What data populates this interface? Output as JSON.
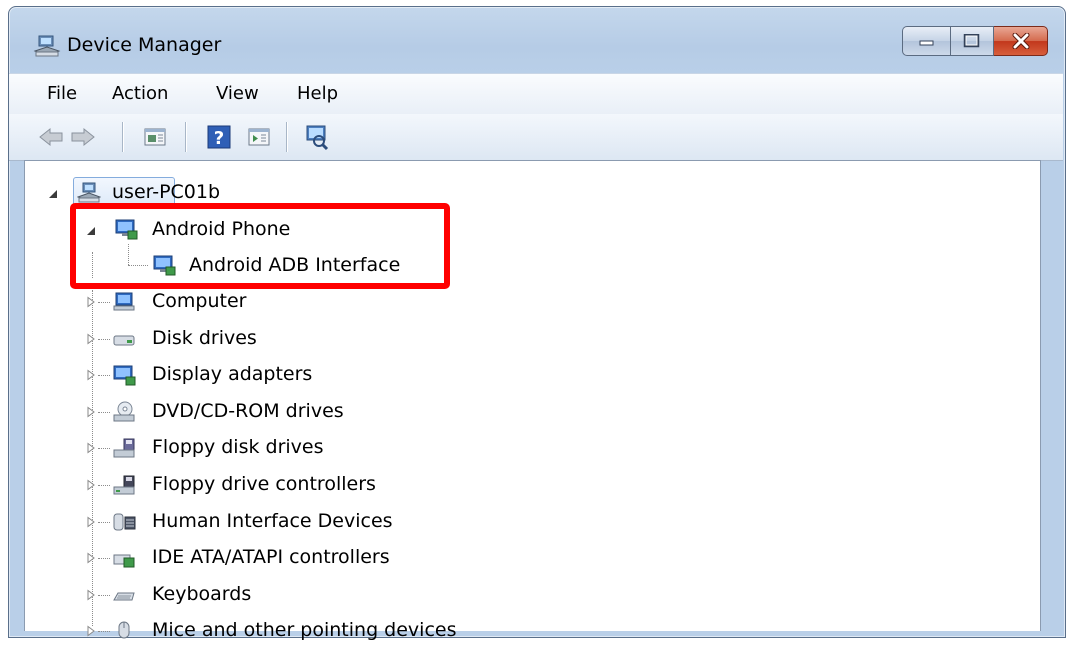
{
  "window": {
    "title": "Device Manager"
  },
  "caption": {
    "minimize": "minimize",
    "maximize": "maximize",
    "close": "close"
  },
  "menu": {
    "items": [
      "File",
      "Action",
      "View",
      "Help"
    ]
  },
  "toolbar": {
    "buttons": [
      "back-icon",
      "forward-icon",
      "properties-icon",
      "help-icon",
      "update-driver-icon",
      "scan-hardware-icon"
    ]
  },
  "tree": {
    "root": "user-PC01b",
    "expanded": {
      "label": "Android Phone",
      "child": "Android ADB Interface"
    },
    "categories": [
      "Computer",
      "Disk drives",
      "Display adapters",
      "DVD/CD-ROM drives",
      "Floppy disk drives",
      "Floppy drive controllers",
      "Human Interface Devices",
      "IDE ATA/ATAPI controllers",
      "Keyboards",
      "Mice and other pointing devices"
    ]
  },
  "colors": {
    "highlight": "#ff0000",
    "title_bg": "#b9cfe8"
  }
}
